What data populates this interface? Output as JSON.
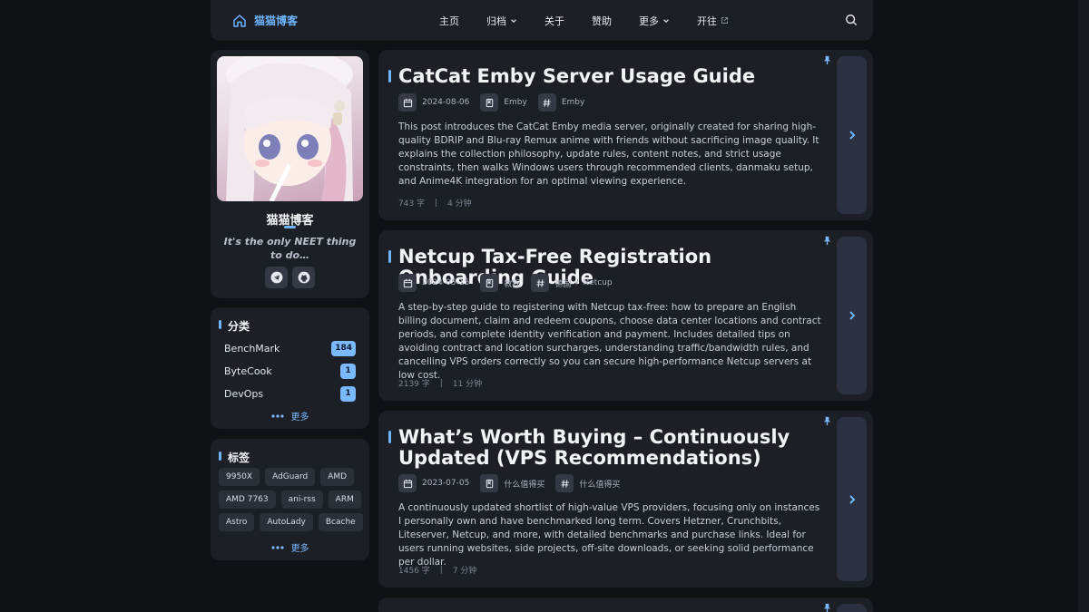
{
  "nav": {
    "brand": "猫猫博客",
    "items": [
      "主页",
      "归档",
      "关于",
      "赞助",
      "更多",
      "开往"
    ]
  },
  "profile": {
    "name": "猫猫博客",
    "motto": "It's the only NEET thing to do…"
  },
  "categories": {
    "title": "分类",
    "items": [
      {
        "name": "BenchMark",
        "count": "184"
      },
      {
        "name": "ByteCook",
        "count": "1"
      },
      {
        "name": "DevOps",
        "count": "1"
      }
    ],
    "more": "更多"
  },
  "tags": {
    "title": "标签",
    "items": [
      "9950X",
      "AdGuard",
      "AMD",
      "AMD 7763",
      "ani-rss",
      "ARM",
      "Astro",
      "AutoLady",
      "Bcache"
    ],
    "more": "更多"
  },
  "posts": [
    {
      "title": "CatCat Emby Server Usage Guide",
      "date": "2024-08-06",
      "category": "Emby",
      "tags": [
        "Emby"
      ],
      "excerpt": "This post introduces the CatCat Emby media server, originally created for sharing high-quality BDRIP and Blu-ray Remux anime with friends without sacrificing image quality. It explains the collection philosophy, update rules, content notes, and strict usage constraints, then walks Windows users through recommended clients, danmaku setup, and Anime4K integration for an optimal viewing experience.",
      "words": "743 字",
      "time": "4 分钟"
    },
    {
      "title": "Netcup Tax-Free Registration Onboarding Guide",
      "date": "2024-05-15",
      "category": "教程",
      "tags": [
        "德国",
        "Netcup"
      ],
      "excerpt": "A step-by-step guide to registering with Netcup tax-free: how to prepare an English billing document, claim and redeem coupons, choose data center locations and contract periods, and complete identity verification and payment. Includes detailed tips on avoiding contract and location surcharges, understanding traffic/bandwidth rules, and cancelling VPS orders correctly so you can secure high-performance Netcup servers at low cost.",
      "words": "2139 字",
      "time": "11 分钟"
    },
    {
      "title": "What’s Worth Buying – Continuously Updated (VPS Recommendations)",
      "date": "2023-07-05",
      "category": "什么值得买",
      "tags": [
        "什么值得买"
      ],
      "excerpt": "A continuously updated shortlist of high-value VPS providers, focusing only on instances I personally own and have benchmarked long term. Covers Hetzner, Crunchbits, Liteserver, Netcup, and more, with detailed benchmarks and purchase links. Ideal for users running websites, side projects, off-site downloads, or seeking solid performance per dollar.",
      "words": "1456 字",
      "time": "7 分钟"
    }
  ],
  "colors": {
    "background": "#0f1115",
    "card": "#1c1f26",
    "accent": "#6eb4ff"
  }
}
